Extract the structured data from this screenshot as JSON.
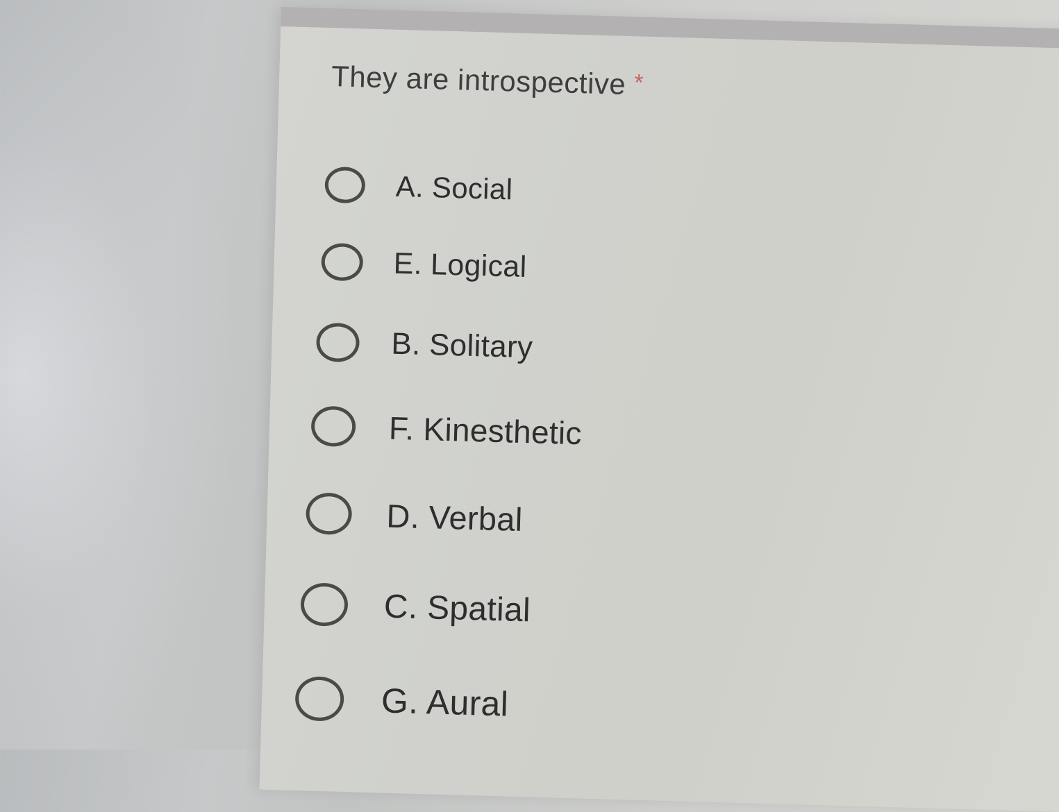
{
  "question": {
    "title": "They are introspective",
    "required_marker": "*"
  },
  "options": [
    {
      "label": "A. Social"
    },
    {
      "label": "E. Logical"
    },
    {
      "label": "B. Solitary"
    },
    {
      "label": "F. Kinesthetic"
    },
    {
      "label": "D. Verbal"
    },
    {
      "label": "C. Spatial"
    },
    {
      "label": "G. Aural"
    }
  ],
  "colors": {
    "required_star": "#c2665e",
    "radio_border": "#4a4a48",
    "text": "#2e2e2e"
  }
}
